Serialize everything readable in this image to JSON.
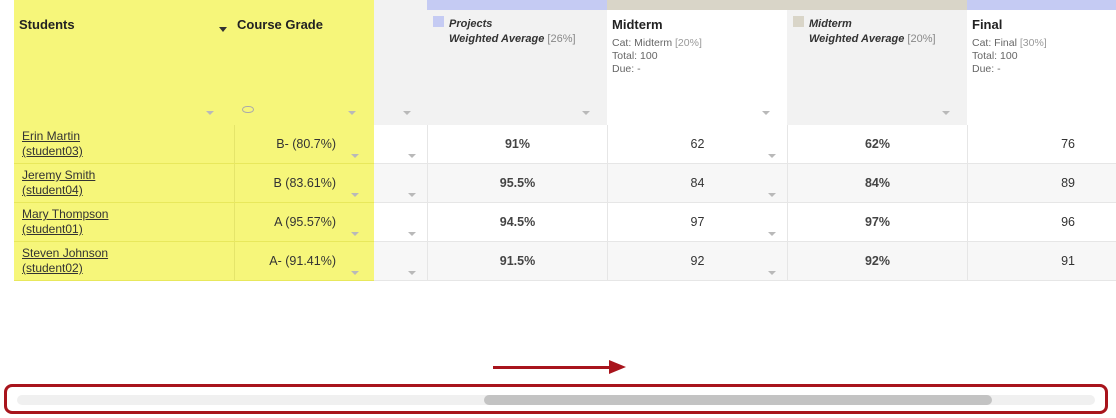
{
  "columns": {
    "students": {
      "title": "Students"
    },
    "course_grade": {
      "title": "Course Grade"
    },
    "projects": {
      "line1": "Projects",
      "line2": "Weighted Average",
      "pct": "[26%]"
    },
    "midterm": {
      "title": "Midterm",
      "cat": "Cat: Midterm",
      "cat_pct": "[20%]",
      "total": "Total: 100",
      "due": "Due: -"
    },
    "midterm_avg": {
      "line1": "Midterm",
      "line2": "Weighted Average",
      "pct": "[20%]"
    },
    "final": {
      "title": "Final",
      "cat": "Cat: Final",
      "cat_pct": "[30%]",
      "total": "Total: 100",
      "due": "Due: -"
    }
  },
  "rows": [
    {
      "name": "Erin Martin",
      "id": "(student03)",
      "grade": "B- (80.7%)",
      "projects": "91%",
      "midterm": "62",
      "midterm_avg": "62%",
      "final": "76"
    },
    {
      "name": "Jeremy Smith",
      "id": "(student04)",
      "grade": "B (83.61%)",
      "projects": "95.5%",
      "midterm": "84",
      "midterm_avg": "84%",
      "final": "89"
    },
    {
      "name": "Mary Thompson",
      "id": "(student01)",
      "grade": "A (95.57%)",
      "projects": "94.5%",
      "midterm": "97",
      "midterm_avg": "97%",
      "final": "96"
    },
    {
      "name": "Steven Johnson",
      "id": "(student02)",
      "grade": "A- (91.41%)",
      "projects": "91.5%",
      "midterm": "92",
      "midterm_avg": "92%",
      "final": "91"
    }
  ],
  "colors": {
    "frozen": "#f6f67a",
    "accent_blue": "#c5cbf3",
    "accent_tan": "#d9d5c8",
    "highlight": "#a8141c"
  },
  "icons": {
    "sort": "sort-caret-down-icon",
    "menu": "dropdown-caret-icon",
    "visibility": "eye-icon"
  }
}
